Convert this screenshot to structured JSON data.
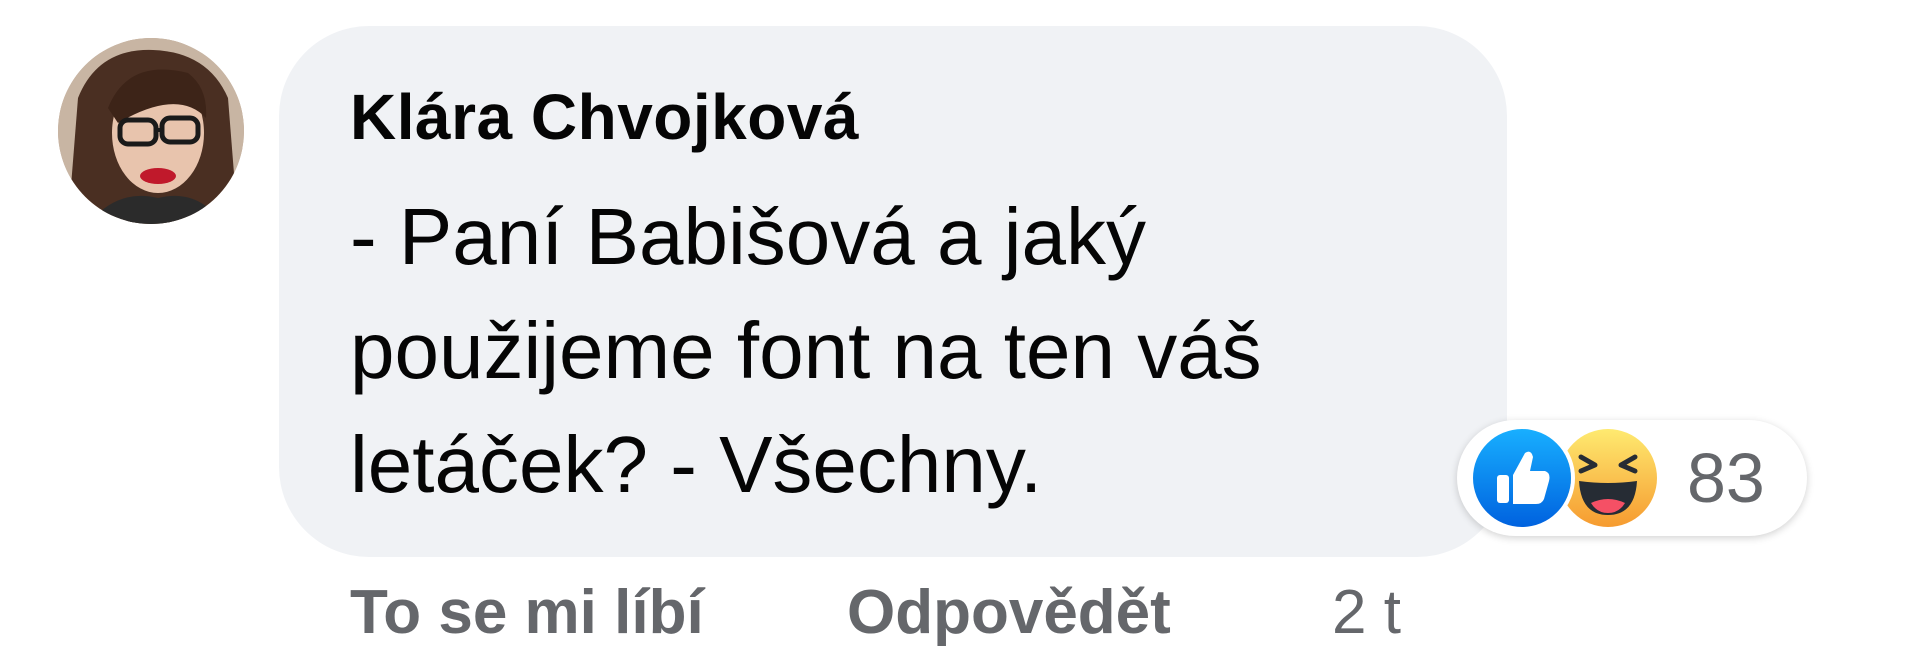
{
  "comment": {
    "author": "Klára Chvojková",
    "text_lines": [
      "- Paní Babišová a jaký",
      "použijeme font na ten váš",
      "letáček? - Všechny."
    ]
  },
  "reactions": {
    "icons": [
      "like-icon",
      "haha-icon"
    ],
    "count": "83",
    "colors": {
      "like": "#1877f2",
      "haha": "#f7b125"
    }
  },
  "actions": {
    "like_label": "To se mi líbí",
    "reply_label": "Odpovědět",
    "time": "2 t"
  }
}
